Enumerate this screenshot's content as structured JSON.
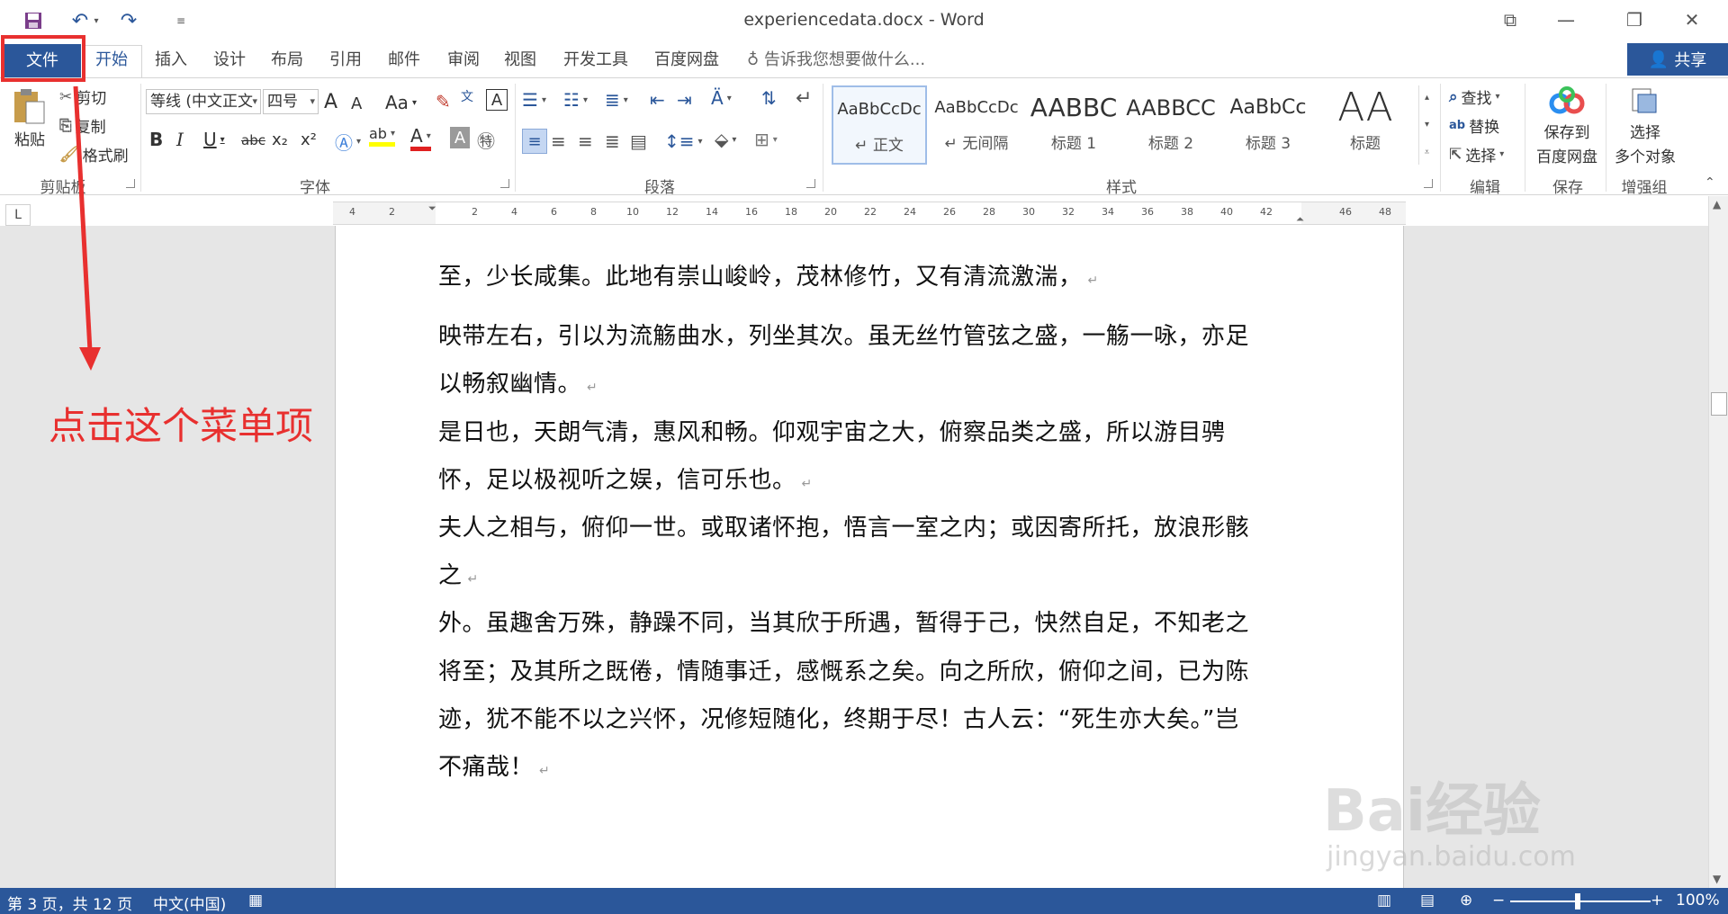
{
  "window": {
    "title": "experiencedata.docx - Word",
    "qat": {
      "save_icon": "save-icon",
      "undo_icon": "undo-icon",
      "redo_icon": "redo-icon",
      "customize_icon": "customize-qat-icon"
    },
    "controls": {
      "ribbon_display": "⧉",
      "minimize": "—",
      "restore": "❐",
      "close": "✕"
    }
  },
  "tabs": {
    "file": "文件",
    "items": [
      "开始",
      "插入",
      "设计",
      "布局",
      "引用",
      "邮件",
      "审阅",
      "视图",
      "开发工具",
      "百度网盘"
    ],
    "tell_me": "告诉我您想要做什么...",
    "share": "共享"
  },
  "ribbon": {
    "clipboard": {
      "paste": "粘贴",
      "cut": "剪切",
      "copy": "复制",
      "format_painter": "格式刷",
      "label": "剪贴板"
    },
    "font": {
      "font_name": "等线 (中文正文",
      "font_size": "四号",
      "label": "字体",
      "grow": "A",
      "shrink": "A",
      "case": "Aa",
      "bold": "B",
      "italic": "I",
      "underline": "U",
      "strike": "abc",
      "subscript": "x₂",
      "superscript": "x²",
      "font_color": "A",
      "char_shade": "A"
    },
    "paragraph": {
      "label": "段落"
    },
    "styles": {
      "label": "样式",
      "items": [
        {
          "sample": "AaBbCcDc",
          "name": "正文"
        },
        {
          "sample": "AaBbCcDc",
          "name": "无间隔"
        },
        {
          "sample": "AABBC",
          "name": "标题 1"
        },
        {
          "sample": "AABBCC",
          "name": "标题 2"
        },
        {
          "sample": "AaBbCc",
          "name": "标题 3"
        },
        {
          "sample": "AA",
          "name": "标题"
        }
      ]
    },
    "editing": {
      "find": "查找",
      "replace": "替换",
      "select": "选择",
      "label": "编辑"
    },
    "save": {
      "line1": "保存到",
      "line2": "百度网盘",
      "label": "保存"
    },
    "enhance": {
      "line1": "选择",
      "line2": "多个对象",
      "label": "增强组"
    }
  },
  "ruler": {
    "ticks": [
      "4",
      "2",
      "2",
      "4",
      "6",
      "8",
      "10",
      "12",
      "14",
      "16",
      "18",
      "20",
      "22",
      "24",
      "26",
      "28",
      "30",
      "32",
      "34",
      "36",
      "38",
      "40",
      "42",
      "46",
      "48"
    ]
  },
  "document": {
    "paragraphs": [
      "至，少长咸集。此地有崇山峻岭，茂林修竹，又有清流激湍，",
      "映带左右，引以为流觞曲水，列坐其次。虽无丝竹管弦之盛，一觞一咏，亦足",
      "以畅叙幽情。",
      "是日也，天朗气清，惠风和畅。仰观宇宙之大，俯察品类之盛，所以游目骋",
      "怀，足以极视听之娱，信可乐也。",
      "夫人之相与，俯仰一世。或取诸怀抱，悟言一室之内；或因寄所托，放浪形骸",
      "之",
      "外。虽趣舍万殊，静躁不同，当其欣于所遇，暂得于己，快然自足，不知老之",
      "将至；及其所之既倦，情随事迁，感慨系之矣。向之所欣，俯仰之间，已为陈",
      "迹，犹不能不以之兴怀，况修短随化，终期于尽！古人云：“死生亦大矣。”岂",
      "不痛哉！"
    ],
    "paragraph_mark": "↵"
  },
  "status": {
    "page": "第 3 页，共 12 页",
    "language": "中文(中国)",
    "zoom": "100%"
  },
  "annotation": {
    "text": "点击这个菜单项",
    "color": "#e8302f"
  },
  "watermark": {
    "brand": "Bai经验",
    "url": "jingyan.baidu.com"
  },
  "colors": {
    "accent": "#2b579a",
    "highlight": "#e8302f"
  }
}
